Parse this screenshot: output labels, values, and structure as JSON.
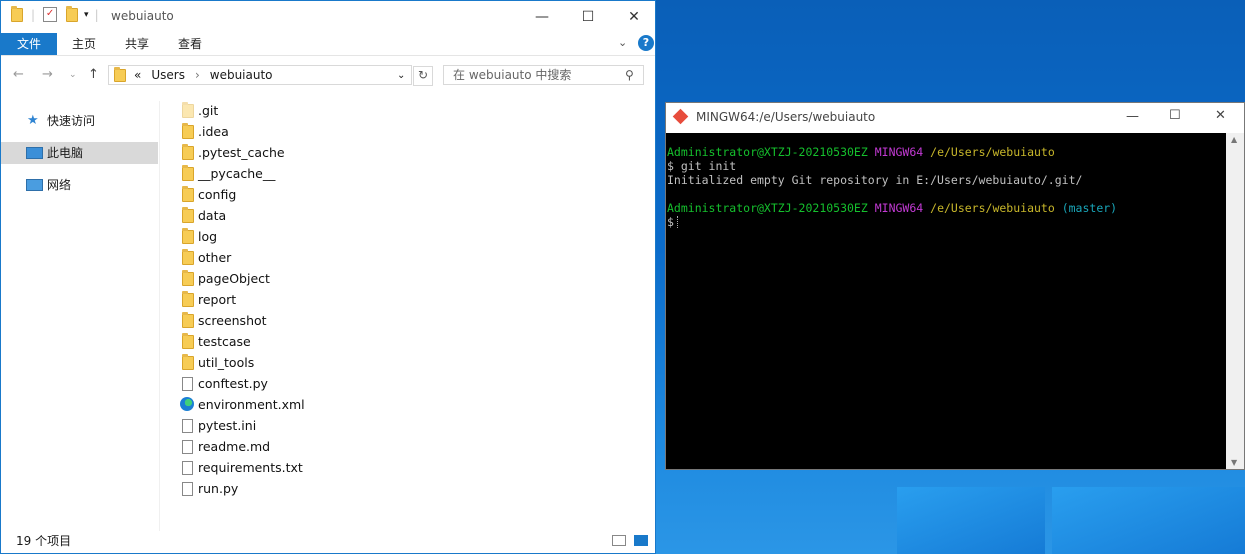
{
  "explorer": {
    "title": "webuiauto",
    "ribbon_tabs": [
      "文件",
      "主页",
      "共享",
      "查看"
    ],
    "address": {
      "prefix": "«",
      "crumbs": [
        "Users",
        "webuiauto"
      ]
    },
    "search_placeholder": "在 webuiauto 中搜索",
    "sidebar": [
      {
        "label": "快速访问",
        "icon": "star-pin-icon"
      },
      {
        "label": "此电脑",
        "icon": "computer-icon",
        "selected": true
      },
      {
        "label": "网络",
        "icon": "network-icon"
      }
    ],
    "files": [
      {
        "name": ".git",
        "type": "folder-hidden"
      },
      {
        "name": ".idea",
        "type": "folder"
      },
      {
        "name": ".pytest_cache",
        "type": "folder"
      },
      {
        "name": "__pycache__",
        "type": "folder"
      },
      {
        "name": "config",
        "type": "folder"
      },
      {
        "name": "data",
        "type": "folder"
      },
      {
        "name": "log",
        "type": "folder"
      },
      {
        "name": "other",
        "type": "folder"
      },
      {
        "name": "pageObject",
        "type": "folder"
      },
      {
        "name": "report",
        "type": "folder"
      },
      {
        "name": "screenshot",
        "type": "folder"
      },
      {
        "name": "testcase",
        "type": "folder"
      },
      {
        "name": "util_tools",
        "type": "folder"
      },
      {
        "name": "conftest.py",
        "type": "python"
      },
      {
        "name": "environment.xml",
        "type": "edge"
      },
      {
        "name": "pytest.ini",
        "type": "ini"
      },
      {
        "name": "readme.md",
        "type": "doc"
      },
      {
        "name": "requirements.txt",
        "type": "text"
      },
      {
        "name": "run.py",
        "type": "python"
      }
    ],
    "status": "19 个项目"
  },
  "terminal": {
    "title": "MINGW64:/e/Users/webuiauto",
    "prompt1": {
      "user": "Administrator@XTZJ-20210530EZ",
      "env": "MINGW64",
      "path": "/e/Users/webuiauto"
    },
    "command": "$ git init",
    "output": "Initialized empty Git repository in E:/Users/webuiauto/.git/",
    "prompt2": {
      "user": "Administrator@XTZJ-20210530EZ",
      "env": "MINGW64",
      "path": "/e/Users/webuiauto",
      "branch": "(master)"
    },
    "cursor_line": "$"
  }
}
